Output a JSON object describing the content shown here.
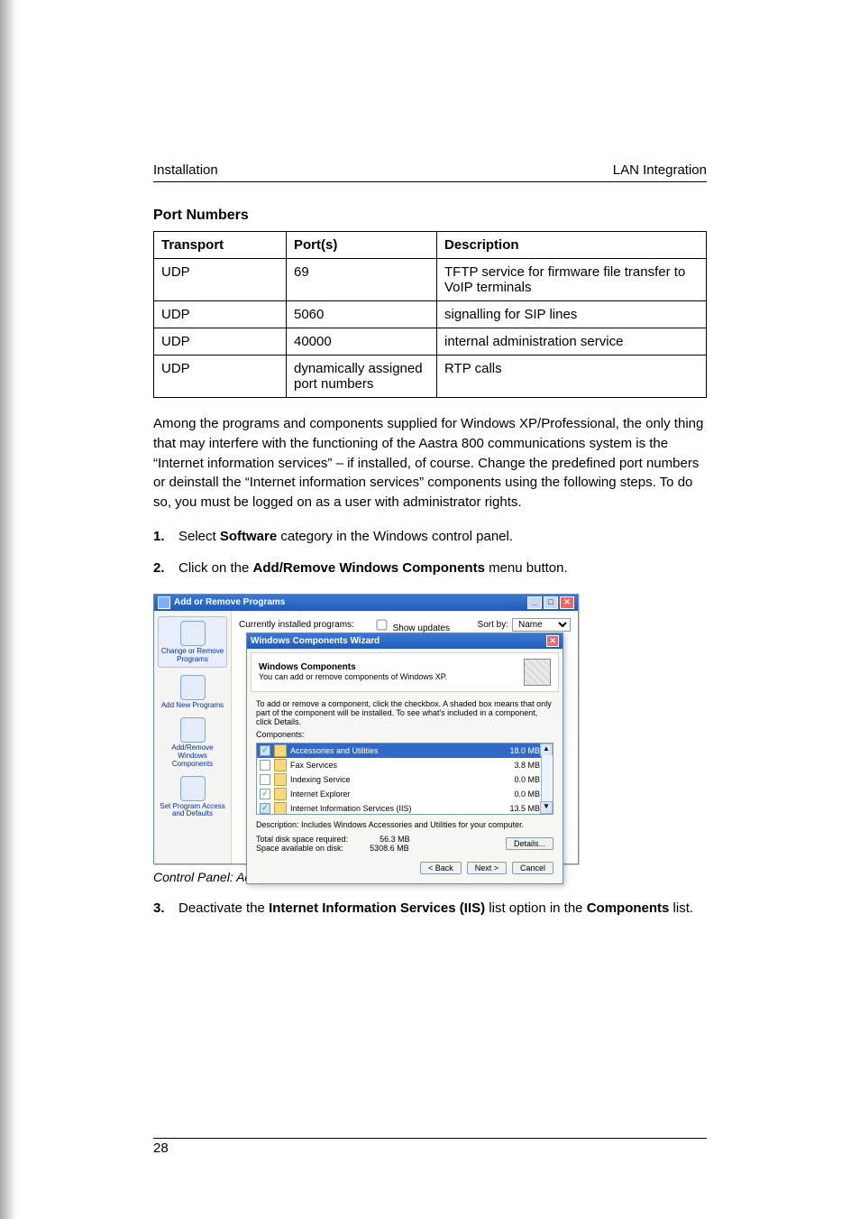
{
  "header": {
    "left": "Installation",
    "right": "LAN Integration"
  },
  "section_title": "Port Numbers",
  "table": {
    "headers": {
      "transport": "Transport",
      "ports": "Port(s)",
      "desc": "Description"
    },
    "rows": [
      {
        "transport": "UDP",
        "ports": "69",
        "desc": "TFTP service for firmware file transfer to VoIP terminals"
      },
      {
        "transport": "UDP",
        "ports": "5060",
        "desc": "signalling for SIP lines"
      },
      {
        "transport": "UDP",
        "ports": "40000",
        "desc": "internal administration service"
      },
      {
        "transport": "UDP",
        "ports": "dynamically as­signed port num­bers",
        "desc": "RTP calls"
      }
    ]
  },
  "paragraph": "Among the programs and components supplied for Windows XP/Professional, the only thing that may interfere with the functioning of the Aastra 800 communica­tions system is the “Internet information services” – if installed, of course. Change the predefined port numbers or deinstall the “Internet information services” com­ponents using the following steps. To do so, you must be logged on as a user with administrator rights.",
  "steps": {
    "s1": {
      "num": "1.",
      "pre": "Select ",
      "bold": "Software",
      "post": " category in the Windows control panel."
    },
    "s2": {
      "num": "2.",
      "pre": "Click on the ",
      "bold": "Add/Remove Windows Components",
      "post": " menu button."
    },
    "s3": {
      "num": "3.",
      "pre": "Deactivate the ",
      "bold1": "Internet Information Services (IIS)",
      "mid": " list option in the ",
      "bold2": "Compo­nents",
      "post": " list."
    }
  },
  "screenshot": {
    "arp_title": "Add or Remove Programs",
    "toprow": {
      "installed_label": "Currently installed programs:",
      "show_updates": "Show updates",
      "sortby_label": "Sort by:",
      "sortby_value": "Name"
    },
    "sidebar": {
      "i1": "Change or Remove Programs",
      "i2": "Add New Programs",
      "i3": "Add/Remove Windows Components",
      "i4": "Set Program Access and Defaults"
    },
    "wizard": {
      "title": "Windows Components Wizard",
      "heading": "Windows Components",
      "subheading": "You can add or remove components of Windows XP.",
      "instructions": "To add or remove a component, click the checkbox. A shaded box means that only part of the component will be installed. To see what's included in a component, click Details.",
      "components_label": "Components:",
      "items": [
        {
          "name": "Accessories and Utilities",
          "size": "18.0 MB",
          "checked": true,
          "shaded": true,
          "selected": true
        },
        {
          "name": "Fax Services",
          "size": "3.8 MB",
          "checked": false,
          "shaded": false,
          "selected": false
        },
        {
          "name": "Indexing Service",
          "size": "0.0 MB",
          "checked": false,
          "shaded": false,
          "selected": false
        },
        {
          "name": "Internet Explorer",
          "size": "0.0 MB",
          "checked": true,
          "shaded": false,
          "selected": false
        },
        {
          "name": "Internet Information Services (IIS)",
          "size": "13.5 MB",
          "checked": true,
          "shaded": true,
          "selected": false
        }
      ],
      "desc_label": "Description:",
      "desc_text": "Includes Windows Accessories and Utilities for your computer.",
      "disk_req_label": "Total disk space required:",
      "disk_req_value": "56.3 MB",
      "disk_avail_label": "Space available on disk:",
      "disk_avail_value": "5308.6 MB",
      "details_btn": "Details...",
      "back_btn": "< Back",
      "next_btn": "Next >",
      "cancel_btn": "Cancel"
    }
  },
  "caption": "Control Panel: Add or Remove Programs: Deinstall IIS",
  "page_number": "28"
}
